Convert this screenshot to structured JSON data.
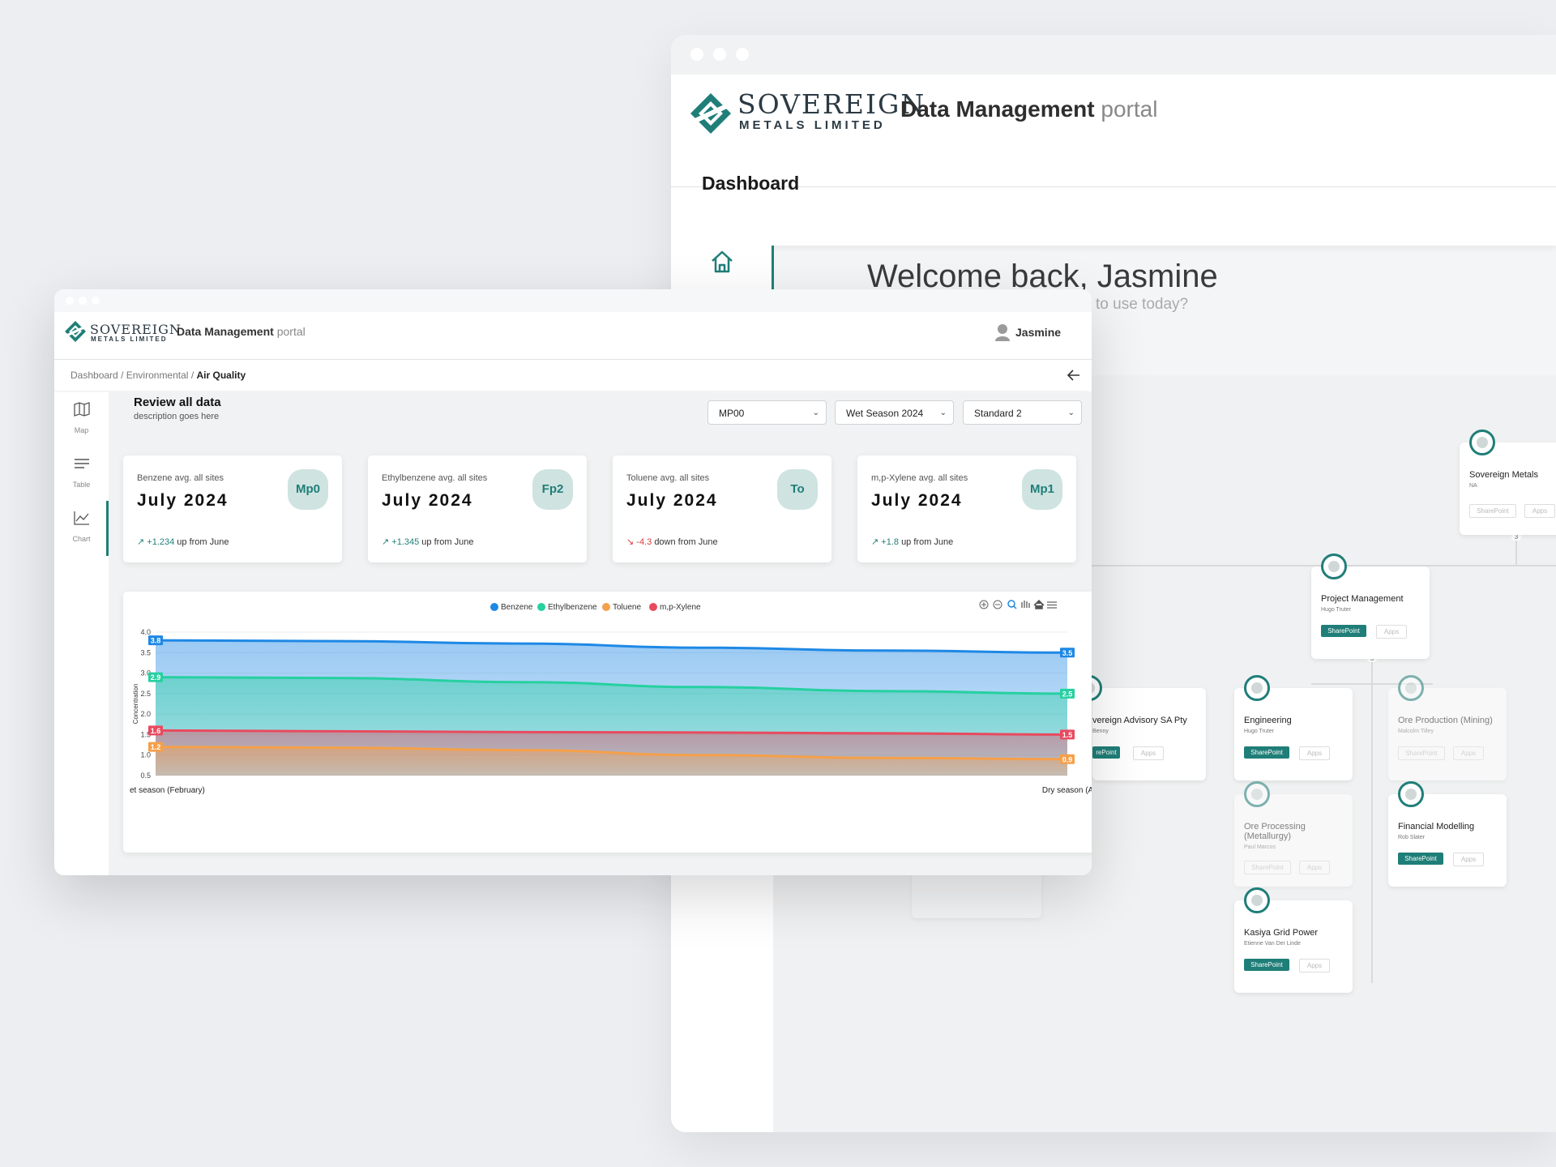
{
  "back_window": {
    "logo": {
      "line1": "SOVEREIGN",
      "line2": "METALS LIMITED"
    },
    "portal_title_bold": "Data Management",
    "portal_title_light": "portal",
    "page_title": "Dashboard",
    "welcome": "Welcome back, Jasmine",
    "welcome_sub": "to use today?",
    "org_nodes": [
      {
        "name": "Sovereign Metals",
        "person": "NA",
        "sp": "SharePoint",
        "apps": "Apps",
        "faded": false
      },
      {
        "name": "Project Management",
        "person": "Hugo Truter",
        "sp": "SharePoint",
        "apps": "Apps",
        "faded": false
      },
      {
        "name": "vereign Advisory SA Pty",
        "person": "Benny",
        "sp": "rePoint",
        "apps": "Apps",
        "faded": false
      },
      {
        "name": "Engineering",
        "person": "Hugo Truter",
        "sp": "SharePoint",
        "apps": "Apps",
        "faded": false
      },
      {
        "name": "Ore Production (Mining)",
        "person": "Malcolm Tilley",
        "sp": "SharePoint",
        "apps": "Apps",
        "faded": true
      },
      {
        "name": "Ore Processing (Metallurgy)",
        "person": "Paul Marcos",
        "sp": "SharePoint",
        "apps": "Apps",
        "faded": true
      },
      {
        "name": "Financial Modelling",
        "person": "Rob Slater",
        "sp": "SharePoint",
        "apps": "Apps",
        "faded": false
      },
      {
        "name": "Kasiya Grid Power",
        "person": "Etienne Van Der Linde",
        "sp": "SharePoint",
        "apps": "Apps",
        "faded": false
      }
    ],
    "connector_counts": [
      "3",
      "5"
    ]
  },
  "front_window": {
    "logo": {
      "line1": "SOVEREIGN",
      "line2": "METALS LIMITED"
    },
    "portal_title_bold": "Data Management",
    "portal_title_light": "portal",
    "user_name": "Jasmine",
    "breadcrumb": {
      "items": [
        "Dashboard",
        "Environmental"
      ],
      "current": "Air Quality",
      "separator": "/"
    },
    "sidebar": [
      {
        "label": "Map",
        "icon": "map-icon"
      },
      {
        "label": "Table",
        "icon": "table-icon"
      },
      {
        "label": "Chart",
        "icon": "chart-icon",
        "active": true
      }
    ],
    "section_title": "Review all data",
    "section_desc": "description goes here",
    "filters": [
      {
        "value": "MP00"
      },
      {
        "value": "Wet Season 2024"
      },
      {
        "value": "Standard 2"
      }
    ],
    "kpis": [
      {
        "label": "Benzene avg. all sites",
        "value": "July 2024",
        "badge": "Mp0",
        "delta": "+1.234",
        "text": "up from June",
        "direction": "up"
      },
      {
        "label": "Ethylbenzene avg. all sites",
        "value": "July 2024",
        "badge": "Fp2",
        "delta": "+1.345",
        "text": "up from June",
        "direction": "up"
      },
      {
        "label": "Toluene avg. all sites",
        "value": "July 2024",
        "badge": "To",
        "delta": "-4.3",
        "text": "down from June",
        "direction": "down"
      },
      {
        "label": "m,p-Xylene avg. all sites",
        "value": "July 2024",
        "badge": "Mp1",
        "delta": "+1.8",
        "text": "up from June",
        "direction": "up"
      }
    ]
  },
  "colors": {
    "accent": "#1f7e78",
    "benzene": "#1e88e5",
    "ethylbenzene": "#26d0a0",
    "toluene": "#f5a04a",
    "xylene": "#e84a5f"
  },
  "chart_data": {
    "type": "area",
    "x": [
      "et season (February)",
      "Dry season (August)"
    ],
    "ylabel": "Concentration",
    "ylim": [
      0.5,
      4.0
    ],
    "yticks": [
      "4.0",
      "3.5",
      "3.0",
      "2.5",
      "2.0",
      "1.5",
      "1.0",
      "0.5"
    ],
    "legend_position": "top-center",
    "series": [
      {
        "name": "Benzene",
        "color": "#1e88e5",
        "values": [
          3.8,
          3.78,
          3.72,
          3.62,
          3.55,
          3.5
        ],
        "start_label": "3.8",
        "end_label": "3.5"
      },
      {
        "name": "Ethylbenzene",
        "color": "#26d0a0",
        "values": [
          2.9,
          2.88,
          2.78,
          2.66,
          2.56,
          2.5
        ],
        "start_label": "2.9",
        "end_label": "2.5"
      },
      {
        "name": "m,p-Xylene",
        "color": "#e84a5f",
        "values": [
          1.6,
          1.58,
          1.56,
          1.55,
          1.53,
          1.5
        ],
        "start_label": "1.6",
        "end_label": "1.5"
      },
      {
        "name": "Toluene",
        "color": "#f5a04a",
        "values": [
          1.2,
          1.18,
          1.12,
          1.0,
          0.93,
          0.9
        ],
        "start_label": "1.2",
        "end_label": "0.9"
      }
    ],
    "legend": [
      "Benzene",
      "Ethylbenzene",
      "Toluene",
      "m,p-Xylene"
    ],
    "toolbar": [
      "zoom-in-icon",
      "zoom-out-icon",
      "magnify-icon",
      "pan-icon",
      "home-icon",
      "menu-icon"
    ]
  }
}
